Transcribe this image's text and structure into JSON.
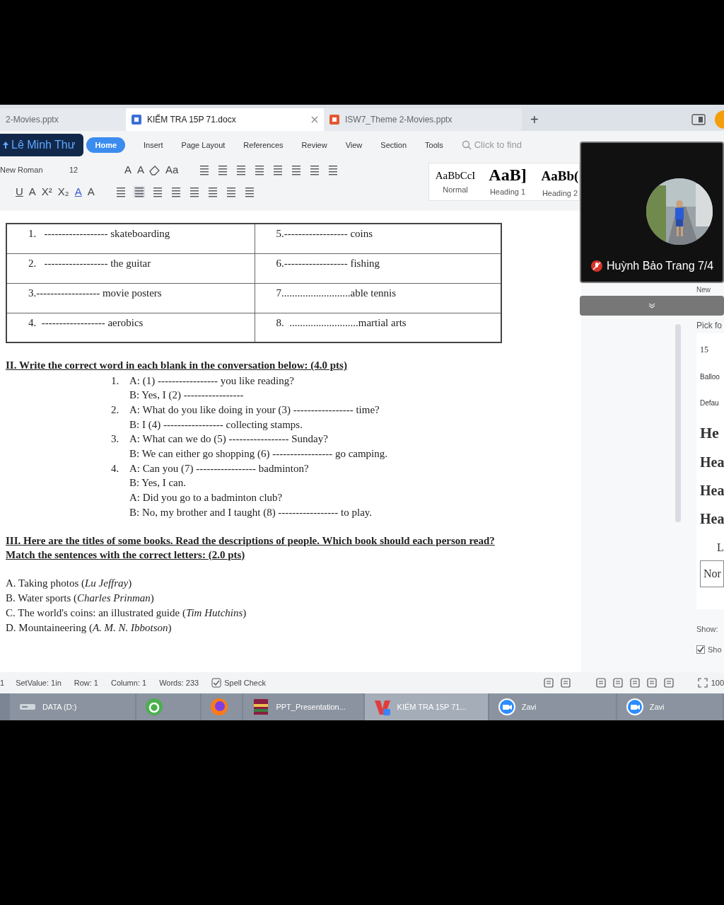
{
  "tabs": [
    {
      "label": "2-Movies.pptx",
      "selected": false
    },
    {
      "label": "KIỂM TRA 15P 71.docx",
      "selected": true,
      "kind": "docx"
    },
    {
      "label": "ISW7_Theme 2-Movies.pptx",
      "selected": false,
      "kind": "pptx"
    }
  ],
  "new_tab": "+",
  "account": "Lê Minh Thư",
  "menu": [
    {
      "label": "Home",
      "selected": true
    },
    {
      "label": "Insert",
      "selected": false
    },
    {
      "label": "Page Layout",
      "selected": false
    },
    {
      "label": "References",
      "selected": false
    },
    {
      "label": "Review",
      "selected": false
    },
    {
      "label": "View",
      "selected": false
    },
    {
      "label": "Section",
      "selected": false
    },
    {
      "label": "Tools",
      "selected": false
    }
  ],
  "search": {
    "placeholder": "Click to find"
  },
  "font": {
    "name": "New Roman",
    "size": "12"
  },
  "glyphs_row1": [
    "A",
    "A",
    "Aa"
  ],
  "glyphs_row2": [
    "U",
    "A",
    "X²",
    "X₂",
    "A",
    "A"
  ],
  "styles": [
    {
      "sample": "AaBbCcI",
      "label": "Normal",
      "kind": "normal"
    },
    {
      "sample": "AaB]",
      "label": "Heading 1",
      "kind": "h1"
    },
    {
      "sample": "AaBb(",
      "label": "Heading 2",
      "kind": "h2"
    }
  ],
  "video": {
    "name": "Huỳnh Bảo Trang 7/4",
    "muted": true
  },
  "document": {
    "table": [
      [
        "1.   ------------------ skateboarding",
        "5.------------------ coins"
      ],
      [
        "2.   ------------------ the guitar",
        "6.------------------ fishing"
      ],
      [
        "3.------------------ movie posters",
        "7..........................able tennis"
      ],
      [
        "4.  ------------------ aerobics",
        "8.  ..........................martial arts"
      ]
    ],
    "section2": {
      "title": "II. Write the correct word in each blank in the conversation below: (4.0 pts)",
      "lines": [
        {
          "number": "1.",
          "text": "A: (1) ----------------- you like reading?"
        },
        {
          "text": "B: Yes, I (2) -----------------"
        },
        {
          "number": "2.",
          "text": "A: What do you like doing in your (3) ----------------- time?"
        },
        {
          "text": "B: I (4) ----------------- collecting stamps."
        },
        {
          "number": "3.",
          "text": "A: What can we do (5) ----------------- Sunday?"
        },
        {
          "text": "B: We can either go shopping (6) ----------------- go camping."
        },
        {
          "number": "4.",
          "text": "A: Can you (7) ----------------- badminton?"
        },
        {
          "text": "B: Yes, I can."
        },
        {
          "text": "A: Did you go to a badminton club?"
        },
        {
          "text": "B: No, my brother and I taught (8) ----------------- to play."
        }
      ]
    },
    "section3": {
      "title": "III. Here are the titles of some books. Read the descriptions of people. Which book should each person read? Match the sentences with the correct letters: (2.0 pts)",
      "books": [
        "A. Taking photos (*Lu Jeffray*)",
        "B. Water sports (*Charles Prinman*)",
        "C. The world's coins: an illustrated guide (*Tim Hutchins*)",
        "D. Mountaineering (*A. M. N. Ibbotson*)"
      ]
    }
  },
  "side_pane": {
    "top": "New",
    "pick": "Pick fo",
    "size": "15",
    "items": [
      "Balloo",
      "Defau"
    ],
    "headings": [
      "He",
      "Hea",
      "Hea",
      "Hea"
    ],
    "list": "L",
    "normal": "Nor",
    "show": "Show:",
    "show_check": {
      "label": "Sho",
      "checked": true
    }
  },
  "status_bar": [
    "1",
    "SetValue: 1in",
    "Row: 1",
    "Column: 1",
    "Words: 233"
  ],
  "spell_check": "Spell Check",
  "zoom": "100",
  "taskbar": [
    {
      "label": "DATA (D:)",
      "kind": "drive",
      "selected": false
    },
    {
      "kind": "green",
      "selected": false
    },
    {
      "kind": "firefox",
      "selected": false
    },
    {
      "label": "PPT_Presentation...",
      "kind": "archive",
      "selected": false
    },
    {
      "label": "KIỂM TRA 15P 71...",
      "kind": "wps",
      "selected": true
    },
    {
      "label": "Zavi",
      "kind": "camera",
      "selected": false
    },
    {
      "label": "Zavi",
      "kind": "camera",
      "selected": false
    }
  ]
}
